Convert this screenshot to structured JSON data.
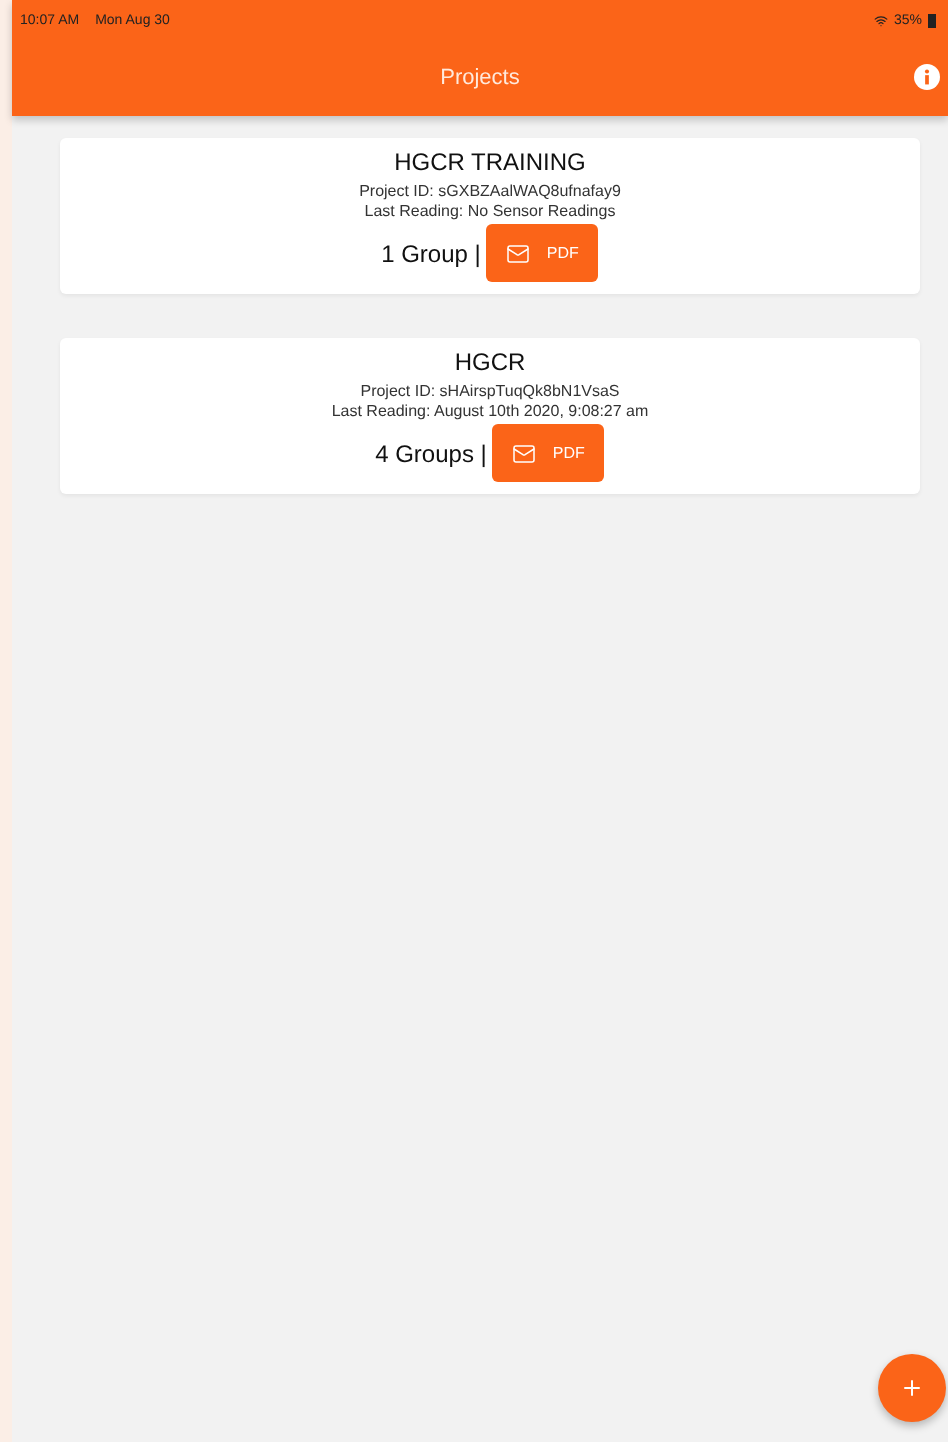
{
  "status_bar": {
    "time": "10:07 AM",
    "date": "Mon Aug 30",
    "battery": "35%"
  },
  "header": {
    "title": "Projects"
  },
  "projects": [
    {
      "name": "HGCR TRAINING",
      "project_id": "Project ID: sGXBZAalWAQ8ufnafay9",
      "last_reading": "Last Reading: No Sensor Readings",
      "groups": "1 Group |",
      "pdf_label": "PDF"
    },
    {
      "name": "HGCR",
      "project_id": "Project ID: sHAirspTuqQk8bN1VsaS",
      "last_reading": "Last Reading: August 10th 2020, 9:08:27 am",
      "groups": "4 Groups |",
      "pdf_label": "PDF"
    }
  ]
}
